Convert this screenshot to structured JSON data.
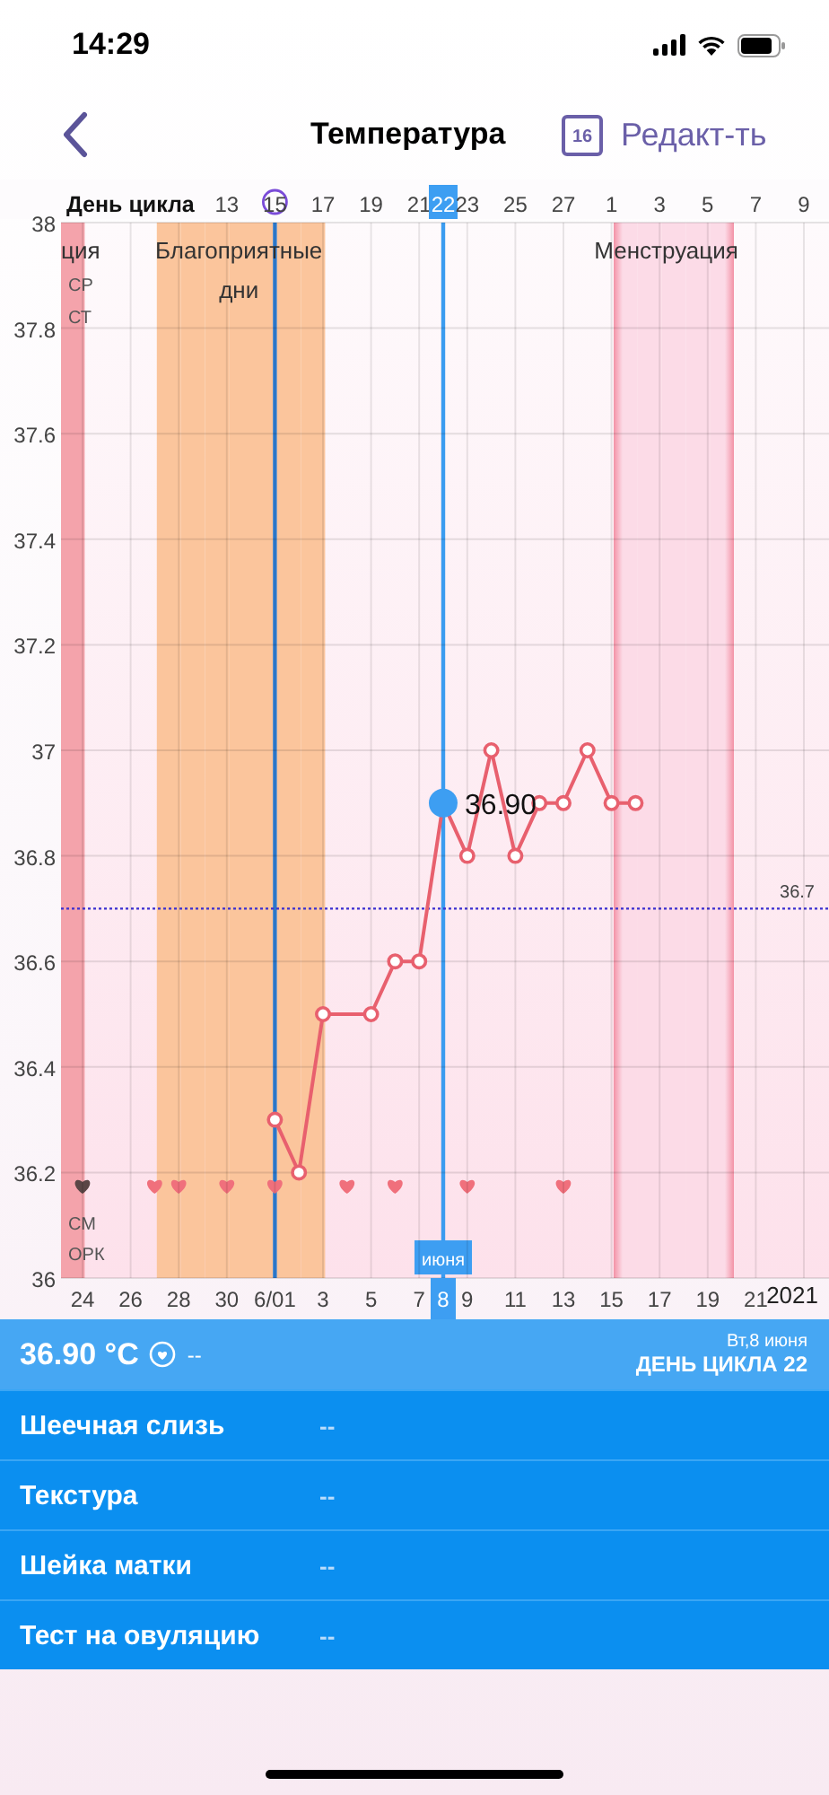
{
  "status_bar": {
    "time": "14:29"
  },
  "nav": {
    "title": "Температура",
    "calendar_day": "16",
    "edit_label": "Редакт-ть"
  },
  "chart": {
    "axis_title": "День цикла",
    "bands": [
      {
        "kind": "period",
        "label": "ция"
      },
      {
        "kind": "fertile",
        "label": "Благоприятные дни"
      },
      {
        "kind": "menstruation",
        "label": "Менструация"
      }
    ],
    "days": [
      {
        "kind": "period",
        "color": "#5b4646"
      },
      {
        "kind": "none"
      },
      {
        "kind": "none"
      },
      {
        "kind": "none",
        "color": "#f0707c"
      },
      {
        "kind": "fertile",
        "color": "#f0707c"
      },
      {
        "kind": "fertile"
      },
      {
        "kind": "fertile",
        "color": "#f0707c",
        "cycle_day": {
          "label": "13",
          "selected": false,
          "ovulation": false
        }
      },
      {
        "kind": "fertile"
      },
      {
        "kind": "fertile",
        "color": "#f0707c",
        "cycle_day": {
          "label": "15",
          "selected": false,
          "ovulation": true
        }
      },
      {
        "kind": "fertile"
      },
      {
        "kind": "fertile",
        "cycle_day": {
          "label": "17",
          "selected": false,
          "ovulation": false
        }
      },
      {
        "kind": "none",
        "color": "#f0707c"
      },
      {
        "kind": "none",
        "cycle_day": {
          "label": "19",
          "selected": false,
          "ovulation": false
        }
      },
      {
        "kind": "none",
        "color": "#f0707c"
      },
      {
        "kind": "none",
        "cycle_day": {
          "label": "21",
          "selected": false,
          "ovulation": false
        }
      },
      {
        "kind": "none",
        "cycle_day": {
          "label": "22",
          "selected": true,
          "ovulation": false
        }
      },
      {
        "kind": "none",
        "color": "#f0707c",
        "cycle_day": {
          "label": "23",
          "selected": false,
          "ovulation": false
        }
      },
      {
        "kind": "none"
      },
      {
        "kind": "none",
        "cycle_day": {
          "label": "25",
          "selected": false,
          "ovulation": false
        }
      },
      {
        "kind": "none"
      },
      {
        "kind": "none",
        "color": "#f0707c",
        "cycle_day": {
          "label": "27",
          "selected": false,
          "ovulation": false
        }
      },
      {
        "kind": "none"
      },
      {
        "kind": "none",
        "cycle_day": {
          "label": "1",
          "selected": false,
          "ovulation": false
        }
      },
      {
        "kind": "menstruation"
      },
      {
        "kind": "menstruation",
        "cycle_day": {
          "label": "3",
          "selected": false,
          "ovulation": false
        }
      },
      {
        "kind": "menstruation"
      },
      {
        "kind": "menstruation",
        "cycle_day": {
          "label": "5",
          "selected": false,
          "ovulation": false
        }
      },
      {
        "kind": "menstruation"
      },
      {
        "kind": "none",
        "cycle_day": {
          "label": "7",
          "selected": false,
          "ovulation": false
        }
      },
      {
        "kind": "none"
      },
      {
        "kind": "none",
        "cycle_day": {
          "label": "9",
          "selected": false,
          "ovulation": false
        }
      },
      {
        "kind": "none"
      }
    ],
    "side_labels_top": [
      "СР",
      "СТ"
    ],
    "side_labels_bottom": [
      "СМ",
      "ОРК"
    ],
    "coverline": "36.7",
    "selected_value": "36.90",
    "selected_month": "июня",
    "year": "2021",
    "chart_data": {
      "type": "line",
      "categories": [
        "24",
        null,
        "26",
        null,
        "28",
        null,
        "30",
        null,
        "6/01",
        null,
        "3",
        null,
        "5",
        null,
        "7",
        "8",
        "9",
        null,
        "11",
        null,
        "13",
        null,
        "15",
        null,
        "17",
        null,
        "19",
        null,
        "21",
        null,
        null,
        null
      ],
      "series": [
        {
          "color": "#e8606e",
          "marker": "o",
          "values": [
            null,
            null,
            null,
            null,
            null,
            null,
            null,
            null,
            36.3,
            36.2,
            36.5,
            null,
            36.5,
            36.6,
            36.6,
            36.9,
            36.8,
            37.0,
            36.8,
            36.9,
            36.9,
            37.0,
            36.9,
            36.9,
            null,
            null,
            null,
            null,
            null,
            null,
            null,
            null
          ]
        }
      ],
      "ylim": [
        36,
        38
      ],
      "yticks": [
        36,
        36.2,
        36.4,
        36.6,
        36.8,
        37,
        37.2,
        37.4,
        37.6,
        37.8,
        38
      ],
      "grid": true
    }
  },
  "details": {
    "temperature": "36.90 °C",
    "note": "--",
    "date": "Вт,8 июня",
    "cycle_day": "ДЕНЬ ЦИКЛА 22",
    "rows": [
      {
        "label": "Шеечная слизь",
        "value": "--"
      },
      {
        "label": "Текстура",
        "value": "--"
      },
      {
        "label": "Шейка матки",
        "value": "--"
      },
      {
        "label": "Тест на овуляцию",
        "value": "--"
      }
    ]
  }
}
